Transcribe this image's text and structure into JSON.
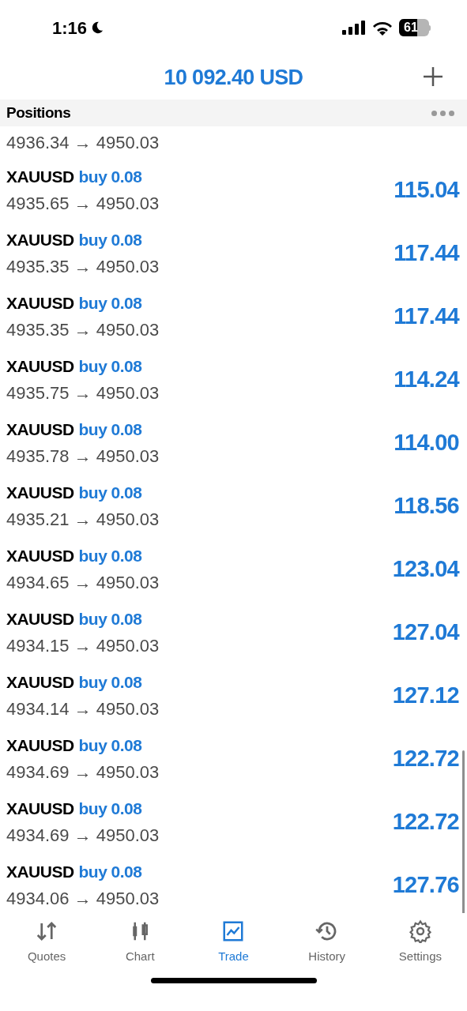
{
  "status_bar": {
    "time": "1:16",
    "battery": "61"
  },
  "header": {
    "title": "10 092.40 USD"
  },
  "section": {
    "title": "Positions"
  },
  "partial_row": {
    "prices": "4936.34 → 4950.03"
  },
  "positions": [
    {
      "symbol": "XAUUSD",
      "side": "buy 0.08",
      "prices": "4935.65 → 4950.03",
      "profit": "115.04"
    },
    {
      "symbol": "XAUUSD",
      "side": "buy 0.08",
      "prices": "4935.35 → 4950.03",
      "profit": "117.44"
    },
    {
      "symbol": "XAUUSD",
      "side": "buy 0.08",
      "prices": "4935.35 → 4950.03",
      "profit": "117.44"
    },
    {
      "symbol": "XAUUSD",
      "side": "buy 0.08",
      "prices": "4935.75 → 4950.03",
      "profit": "114.24"
    },
    {
      "symbol": "XAUUSD",
      "side": "buy 0.08",
      "prices": "4935.78 → 4950.03",
      "profit": "114.00"
    },
    {
      "symbol": "XAUUSD",
      "side": "buy 0.08",
      "prices": "4935.21 → 4950.03",
      "profit": "118.56"
    },
    {
      "symbol": "XAUUSD",
      "side": "buy 0.08",
      "prices": "4934.65 → 4950.03",
      "profit": "123.04"
    },
    {
      "symbol": "XAUUSD",
      "side": "buy 0.08",
      "prices": "4934.15 → 4950.03",
      "profit": "127.04"
    },
    {
      "symbol": "XAUUSD",
      "side": "buy 0.08",
      "prices": "4934.14 → 4950.03",
      "profit": "127.12"
    },
    {
      "symbol": "XAUUSD",
      "side": "buy 0.08",
      "prices": "4934.69 → 4950.03",
      "profit": "122.72"
    },
    {
      "symbol": "XAUUSD",
      "side": "buy 0.08",
      "prices": "4934.69 → 4950.03",
      "profit": "122.72"
    },
    {
      "symbol": "XAUUSD",
      "side": "buy 0.08",
      "prices": "4934.06 → 4950.03",
      "profit": "127.76"
    }
  ],
  "tabs": [
    {
      "label": "Quotes",
      "kind": "quotes",
      "selected": false
    },
    {
      "label": "Chart",
      "kind": "chart",
      "selected": false
    },
    {
      "label": "Trade",
      "kind": "trade",
      "selected": true
    },
    {
      "label": "History",
      "kind": "history",
      "selected": false
    },
    {
      "label": "Settings",
      "kind": "settings",
      "selected": false
    }
  ]
}
